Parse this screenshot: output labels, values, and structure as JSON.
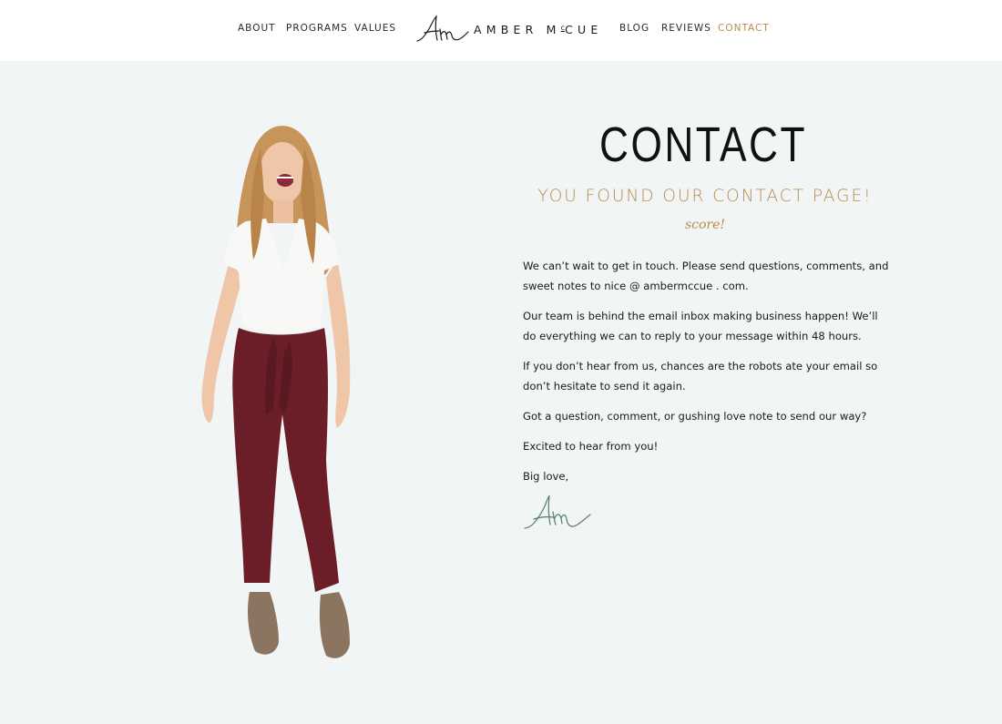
{
  "nav": {
    "left": [
      {
        "label": "ABOUT"
      },
      {
        "label": "PROGRAMS"
      },
      {
        "label": "VALUES"
      }
    ],
    "right": [
      {
        "label": "BLOG"
      },
      {
        "label": "REVIEWS"
      },
      {
        "label": "CONTACT",
        "active": true
      }
    ],
    "logo": {
      "mark": "Am",
      "name_part1": "AMBER M",
      "name_sup": "c",
      "name_part2": "CUE"
    }
  },
  "colors": {
    "accent": "#b88b4a",
    "page_bg": "#f1f5f6",
    "header_bg": "#ffffff",
    "signature": "#5e8278"
  },
  "hero": {
    "image_alt": "Woman laughing in white t-shirt and burgundy pants"
  },
  "contact": {
    "title": "CONTACT",
    "subtitle": "YOU FOUND OUR CONTACT PAGE!",
    "tagline": "score!",
    "paragraphs": [
      "We can’t wait to get in touch. Please send questions, comments, and sweet notes to nice @ ambermccue . com.",
      "Our team is behind the email inbox making business happen! We’ll do everything we can to reply to your message within 48 hours.",
      "If you don’t hear from us, chances are the robots ate your email so don’t hesitate to send it again.",
      "Got a question, comment, or gushing love note to send our way?",
      "Excited to hear from you!",
      "Big love,"
    ],
    "signature": "Am"
  }
}
